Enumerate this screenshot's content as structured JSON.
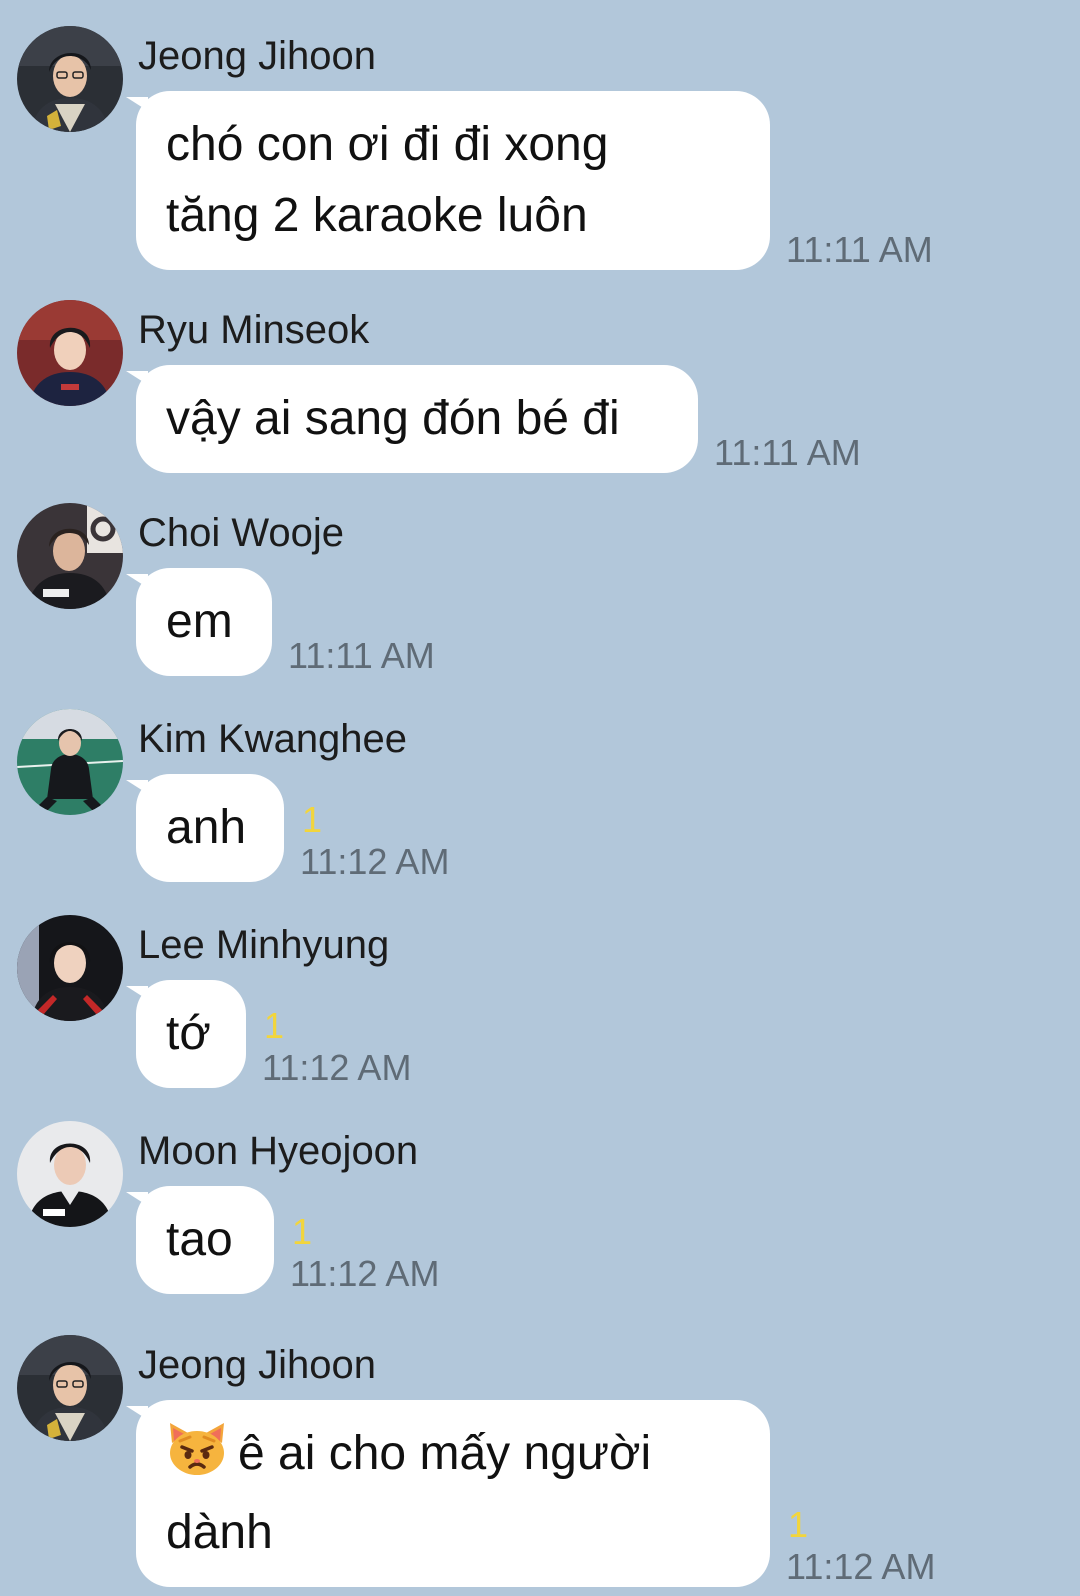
{
  "chat": {
    "background": "#b2c7da",
    "messages": [
      {
        "sender": "Jeong Jihoon",
        "avatar": "jeong-jihoon-avatar",
        "text": "chó con ơi đi đi xong\ntăng 2 karaoke luôn",
        "time": "11:11 AM",
        "unread": ""
      },
      {
        "sender": "Ryu Minseok",
        "avatar": "ryu-minseok-avatar",
        "text": "vậy ai sang đón bé đi",
        "time": "11:11 AM",
        "unread": ""
      },
      {
        "sender": "Choi Wooje",
        "avatar": "choi-wooje-avatar",
        "text": "em",
        "time": "11:11 AM",
        "unread": ""
      },
      {
        "sender": "Kim Kwanghee",
        "avatar": "kim-kwanghee-avatar",
        "text": "anh",
        "time": "11:12 AM",
        "unread": "1"
      },
      {
        "sender": "Lee Minhyung",
        "avatar": "lee-minhyung-avatar",
        "text": "tớ",
        "time": "11:12 AM",
        "unread": "1"
      },
      {
        "sender": "Moon Hyeojoon",
        "avatar": "moon-hyeojoon-avatar",
        "text": "tao",
        "time": "11:12 AM",
        "unread": "1"
      },
      {
        "sender": "Jeong Jihoon",
        "avatar": "jeong-jihoon-avatar",
        "emoji": "pouting-cat-emoji",
        "text": "ê ai cho mấy người\ndành",
        "time": "11:12 AM",
        "unread": "1"
      }
    ]
  }
}
